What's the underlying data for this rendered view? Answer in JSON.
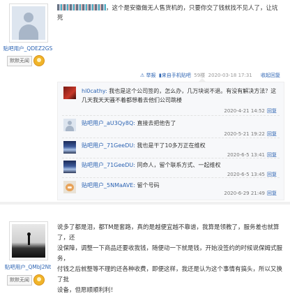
{
  "post1": {
    "username": "贴吧用户_QDEZ2GS",
    "badge": "默默无闻",
    "content_line1": "，这个是安徽做无人售货机的，只要你交了钱就找不见人了，让坑",
    "content_line2": "死",
    "meta": {
      "report": "举报",
      "from": "来自手机贴吧",
      "floor": "59楼",
      "time": "2020-03-18 17:31",
      "reply": "收起回复"
    },
    "comments": [
      {
        "nick": "hl0cathy:",
        "text1": " 我也是这个公司签的，怎么办，几万块说不退。有没有解决方法？这",
        "text2": "几天我天天骚不着都想着去他们公司跳楼",
        "time": "2020-4-21 14:52",
        "reply": "回复",
        "avatar": "red"
      },
      {
        "nick": "贴吧用户_aU3Qy8Q:",
        "text1": " 直接去把他告了",
        "time": "2020-5-21 19:22",
        "reply": "回复",
        "avatar": "blank"
      },
      {
        "nick": "贴吧用户_71GeeDU:",
        "text1": " 我也是干了10多万正在维权",
        "time": "2020-6-5 13:41",
        "reply": "回复",
        "avatar": "sky"
      },
      {
        "nick": "贴吧用户_71GeeDU:",
        "text1": " 同命人，留个联系方式、一起维权",
        "time": "2020-6-5 13:45",
        "reply": "回复",
        "avatar": "sky"
      },
      {
        "nick": "贴吧用户_5NMaAVE:",
        "text1": " 留个号码",
        "time": "2020-6-29 21:49",
        "reply": "回复",
        "avatar": "cat"
      }
    ]
  },
  "post2": {
    "username": "贴吧用户_QMbJ2Nt",
    "badge": "默默无闻",
    "lines": [
      "说多了都是泪，都TM是套路，真的是越便宜越不靠谱，我算是领教了，服务差也就算了，还",
      "没保障，调整一下商品还要收我钱，随便动一下就是钱，开始没签约的时候说保姆式服务，",
      "付钱之后就整等不理的还各种收费，即便这样，我还是认为这个事情有搞头，所以又换了批",
      "设备，但愿顺顺利利！"
    ]
  }
}
